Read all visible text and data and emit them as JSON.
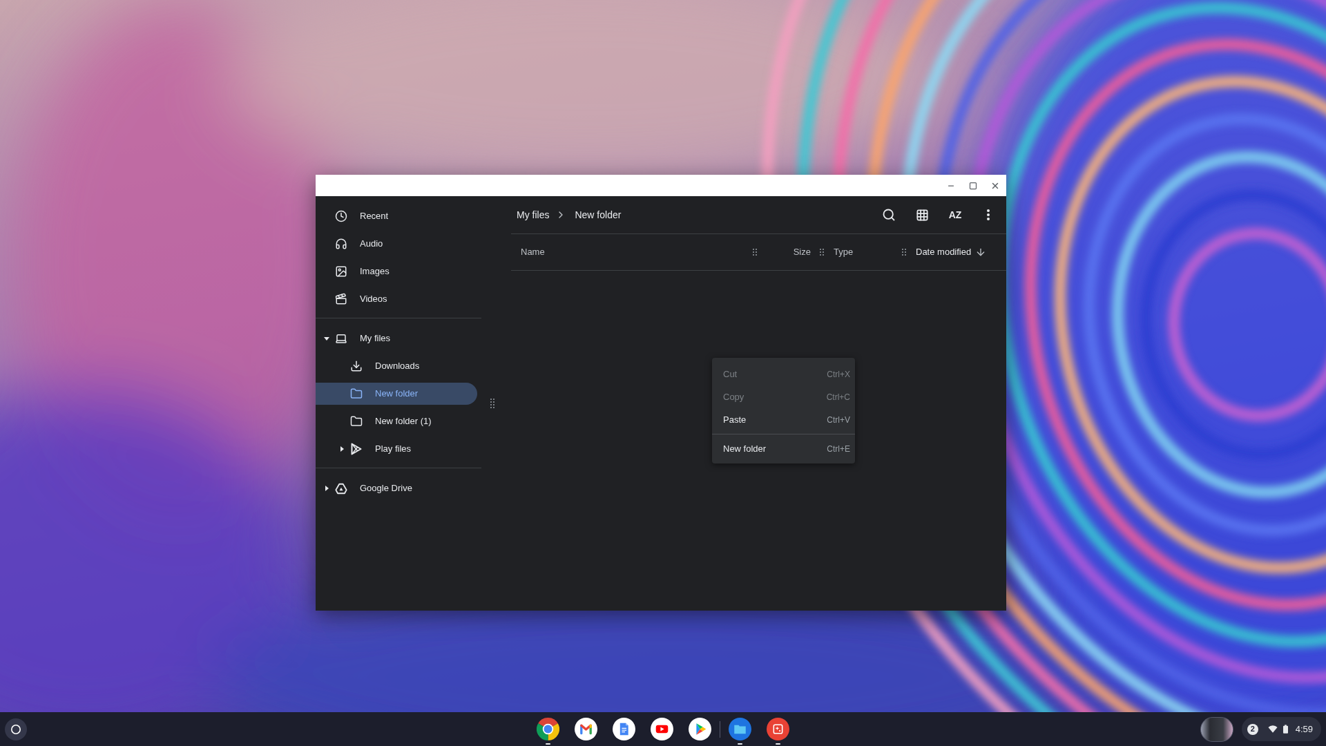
{
  "sidebar": {
    "sections": [
      {
        "items": [
          {
            "label": "Recent",
            "selected": false
          },
          {
            "label": "Audio",
            "selected": false
          },
          {
            "label": "Images",
            "selected": false
          },
          {
            "label": "Videos",
            "selected": false
          }
        ]
      },
      {
        "items": [
          {
            "label": "My files",
            "selected": false,
            "expanded": true,
            "children": [
              {
                "label": "Downloads",
                "selected": false
              },
              {
                "label": "New folder",
                "selected": true
              },
              {
                "label": "New folder (1)",
                "selected": false
              },
              {
                "label": "Play files",
                "selected": false,
                "expanded": false
              }
            ]
          }
        ]
      },
      {
        "items": [
          {
            "label": "Google Drive",
            "selected": false,
            "expanded": false
          }
        ]
      }
    ]
  },
  "breadcrumb": [
    "My files",
    "New folder"
  ],
  "toolbar": {
    "sort_label": "AZ"
  },
  "columns": [
    {
      "label": "Name",
      "sorted": false
    },
    {
      "label": "Size",
      "sorted": false
    },
    {
      "label": "Type",
      "sorted": false
    },
    {
      "label": "Date modified",
      "sorted": true
    }
  ],
  "context_menu": {
    "groups": [
      [
        {
          "label": "Cut",
          "shortcut": "Ctrl+X",
          "disabled": true
        },
        {
          "label": "Copy",
          "shortcut": "Ctrl+C",
          "disabled": true
        },
        {
          "label": "Paste",
          "shortcut": "Ctrl+V",
          "disabled": false
        }
      ],
      [
        {
          "label": "New folder",
          "shortcut": "Ctrl+E",
          "disabled": false
        }
      ]
    ]
  },
  "shelf": {
    "groups": [
      [
        {
          "running": true
        },
        {
          "running": false
        },
        {
          "running": false
        },
        {
          "running": false
        },
        {
          "running": false
        }
      ],
      [
        {
          "running": true
        },
        {
          "running": true
        }
      ]
    ]
  },
  "status_area": {
    "notification_count": "2",
    "time": "4:59"
  }
}
